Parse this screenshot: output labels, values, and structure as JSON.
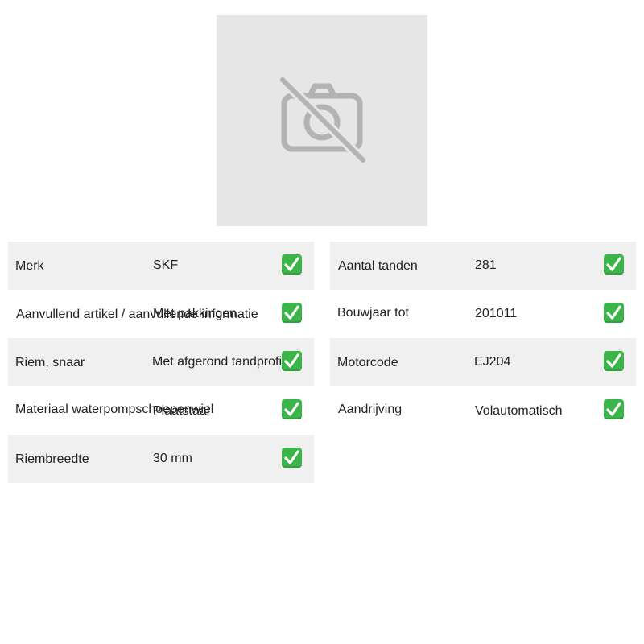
{
  "image": {
    "icon": "camera-off-icon",
    "background": "#e6e6e6",
    "icon_color": "#b3b3b3"
  },
  "check_icon": "check-mark-icon",
  "check_color": "#3bb54a",
  "left_specs": [
    {
      "label": "Merk",
      "value": "SKF"
    },
    {
      "label": "Aanvullend artikel / aanvullende informatie",
      "value": "Met pakkingen"
    },
    {
      "label": "Riem, snaar",
      "value": "Met afgerond tandprofiel"
    },
    {
      "label": "Materiaal waterpompschoepenwiel",
      "value": "Plaatstaal"
    },
    {
      "label": "Riembreedte",
      "value": "30 mm"
    }
  ],
  "right_specs": [
    {
      "label": "Aantal tanden",
      "value": "281"
    },
    {
      "label": "Bouwjaar tot",
      "value": "201011"
    },
    {
      "label": "Motorcode",
      "value": "EJ204"
    },
    {
      "label": "Aandrijving",
      "value": "Volautomatisch"
    }
  ]
}
